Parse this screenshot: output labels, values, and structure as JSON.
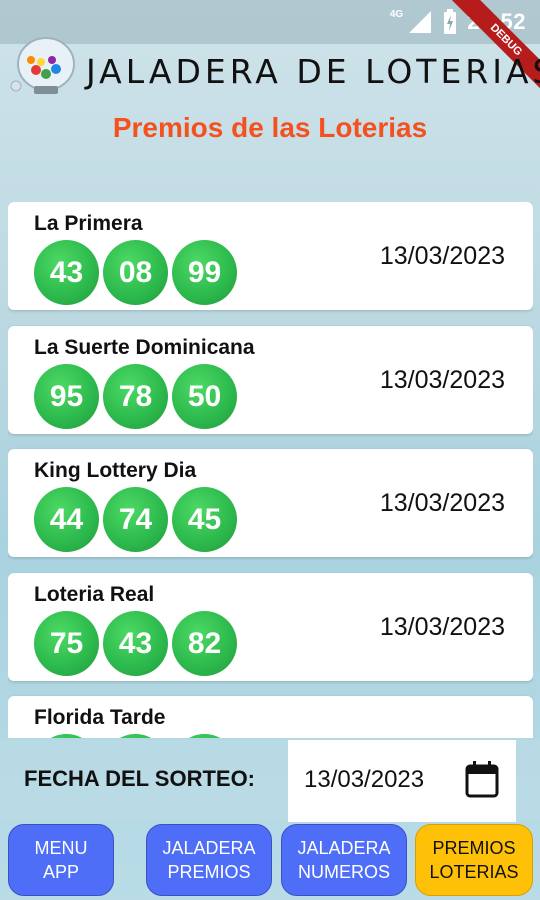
{
  "status_bar": {
    "network": "4G",
    "time": "22:52"
  },
  "debug_banner": "DEBUG",
  "header": {
    "title": "JALADERA DE LOTERIAS",
    "subtitle": "Premios de las Loterias"
  },
  "results": [
    {
      "name": "La Primera",
      "numbers": [
        "43",
        "08",
        "99"
      ],
      "date": "13/03/2023"
    },
    {
      "name": "La Suerte Dominicana",
      "numbers": [
        "95",
        "78",
        "50"
      ],
      "date": "13/03/2023"
    },
    {
      "name": "King Lottery Dia",
      "numbers": [
        "44",
        "74",
        "45"
      ],
      "date": "13/03/2023"
    },
    {
      "name": "Loteria Real",
      "numbers": [
        "75",
        "43",
        "82"
      ],
      "date": "13/03/2023"
    },
    {
      "name": "Florida Tarde",
      "numbers": [
        "",
        "",
        ""
      ],
      "date": ""
    }
  ],
  "draw_date": {
    "label": "FECHA DEL SORTEO:",
    "value": "13/03/2023",
    "icon": "calendar-icon"
  },
  "nav": [
    {
      "label_line1": "MENU",
      "label_line2": "APP",
      "active": false
    },
    {
      "label_line1": "JALADERA",
      "label_line2": "PREMIOS",
      "active": false
    },
    {
      "label_line1": "JALADERA",
      "label_line2": "NUMEROS",
      "active": false
    },
    {
      "label_line1": "PREMIOS",
      "label_line2": "LOTERIAS",
      "active": true
    }
  ],
  "colors": {
    "accent": "#f4511e",
    "ball": "#2ebb4e",
    "nav_button": "#4f6ef7",
    "nav_active": "#ffc107"
  }
}
